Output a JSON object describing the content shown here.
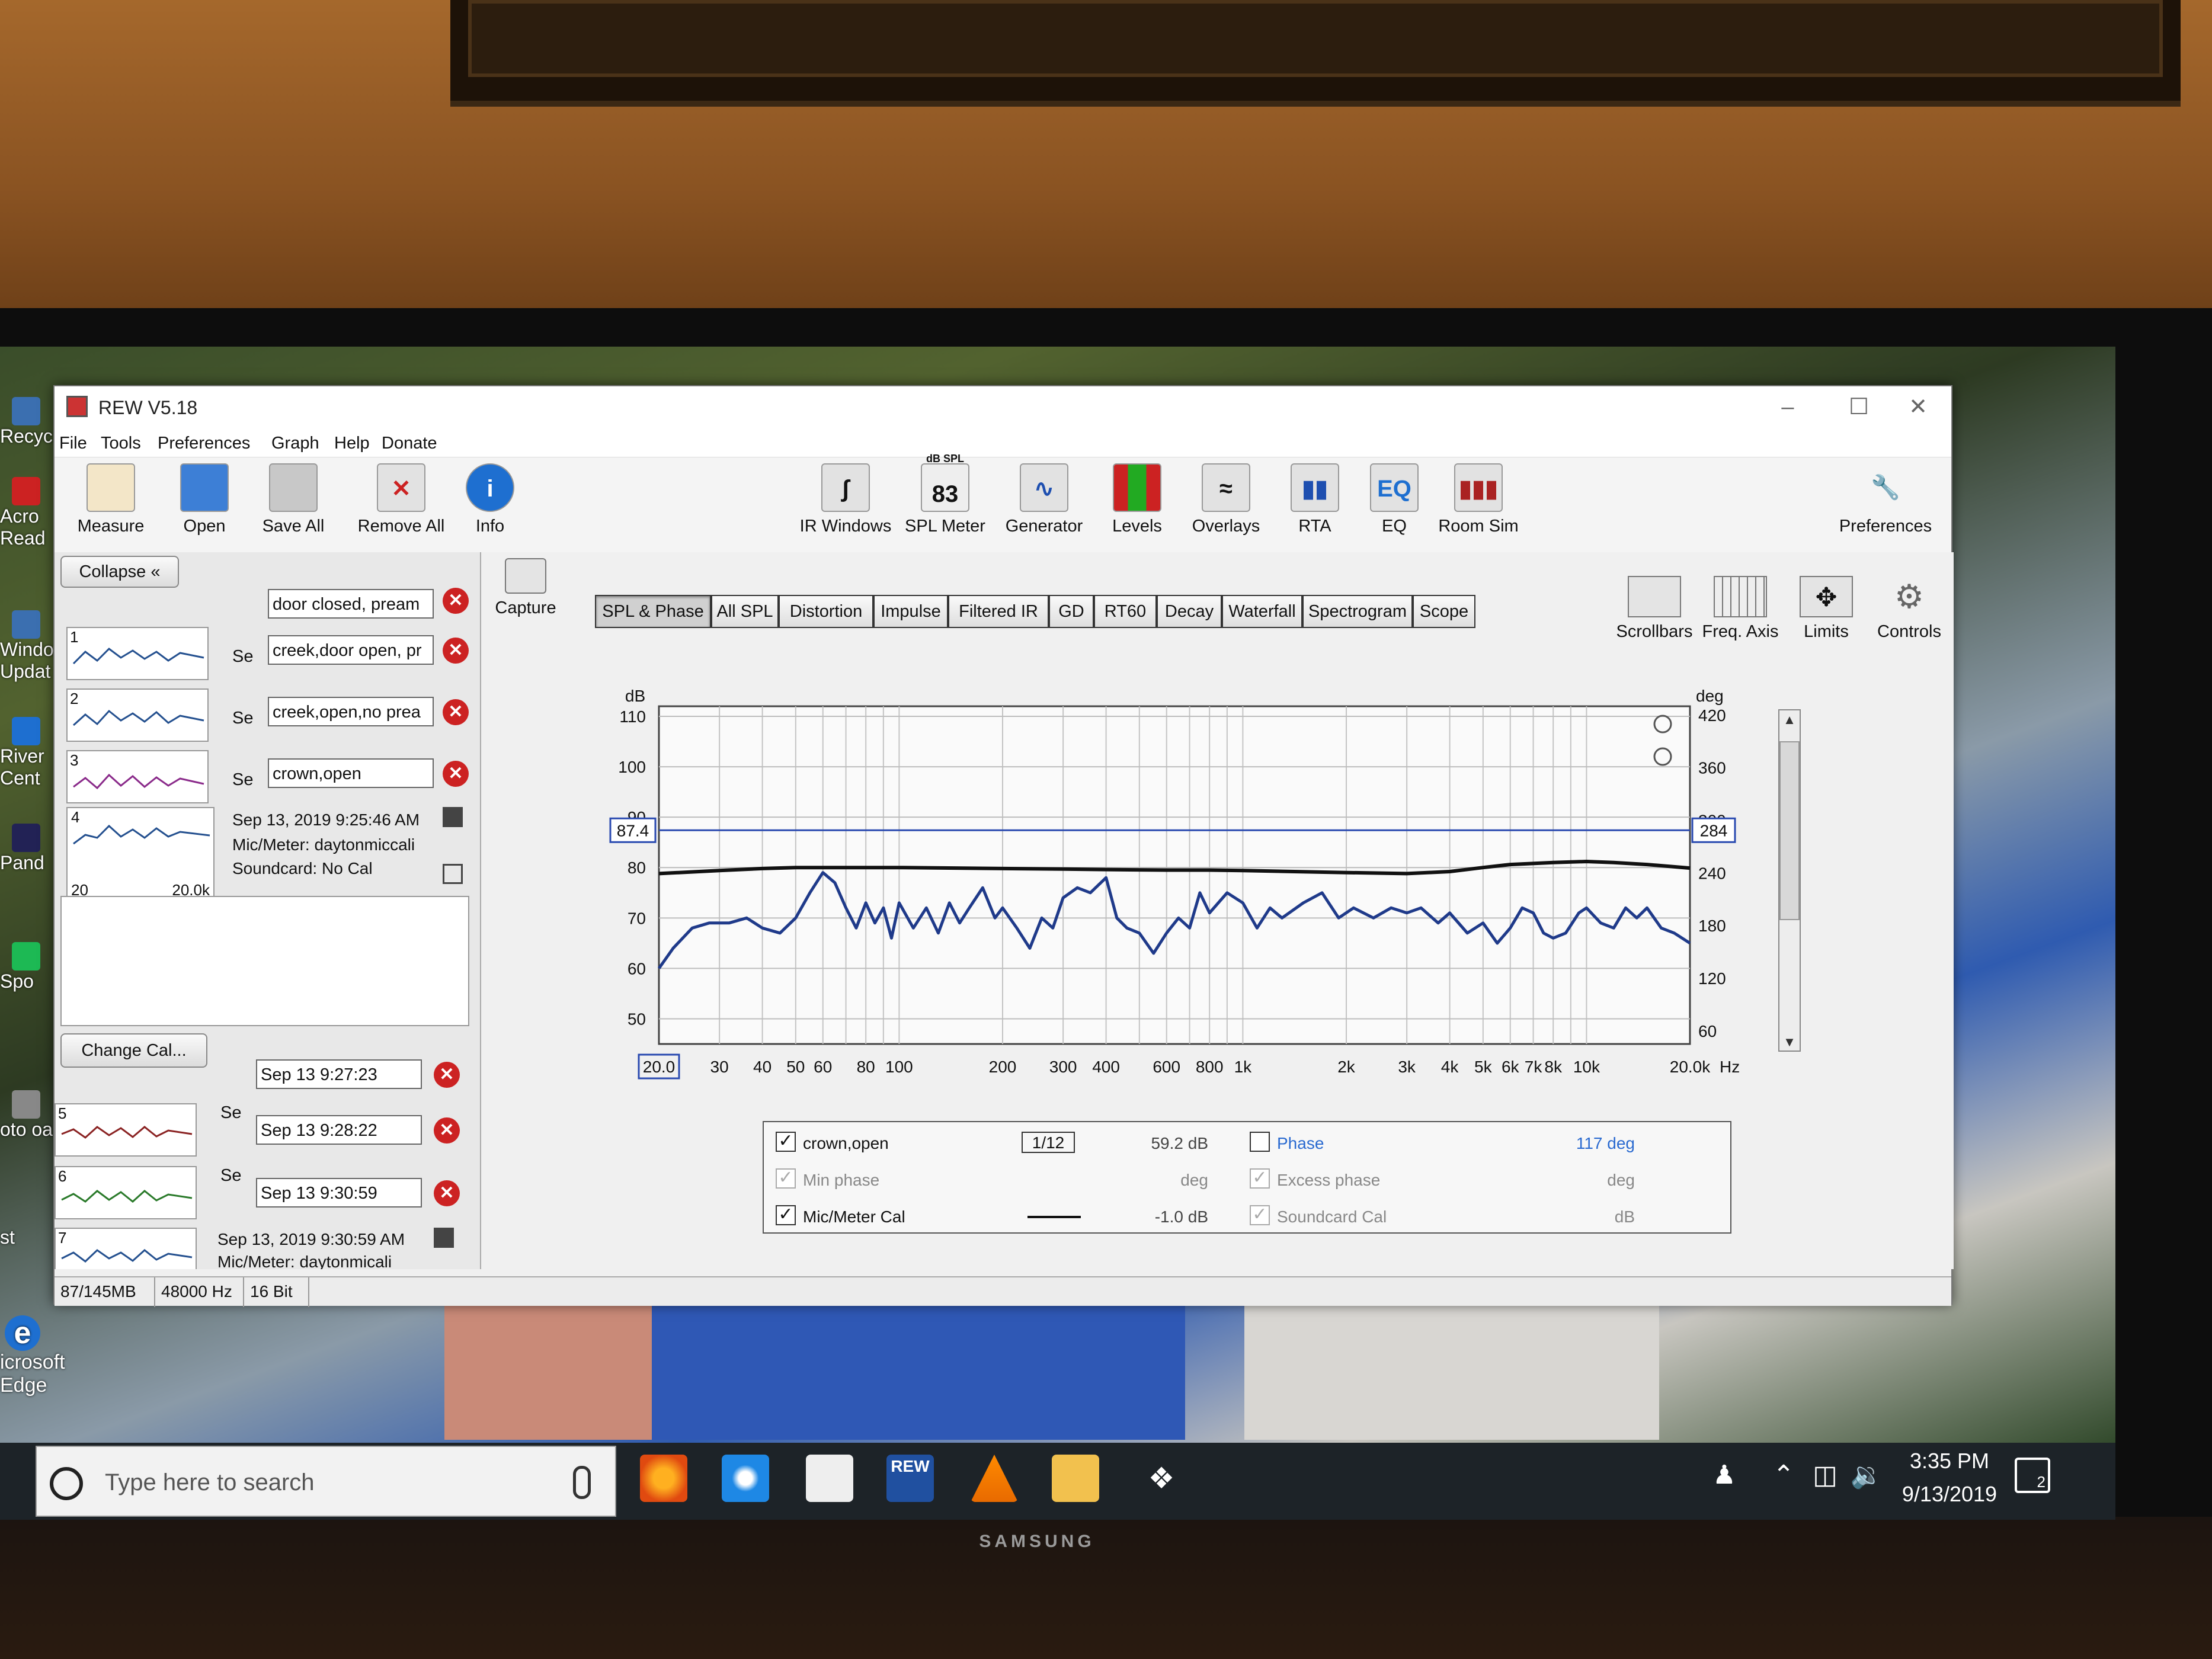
{
  "window": {
    "title": "REW V5.18"
  },
  "menu": [
    "File",
    "Tools",
    "Preferences",
    "Graph",
    "Help",
    "Donate"
  ],
  "toolbar_left": [
    {
      "label": "Measure",
      "icon": "measure-icon"
    },
    {
      "label": "Open",
      "icon": "folder-icon"
    },
    {
      "label": "Save All",
      "icon": "save-icon"
    },
    {
      "label": "Remove All",
      "icon": "remove-all-icon"
    },
    {
      "label": "Info",
      "icon": "info-icon"
    }
  ],
  "toolbar_mid": [
    {
      "label": "IR Windows",
      "icon": "ir-windows-icon"
    },
    {
      "label": "SPL Meter",
      "icon": "spl-meter-icon",
      "badge_top": "dB SPL",
      "badge_value": "83"
    },
    {
      "label": "Generator",
      "icon": "generator-icon"
    },
    {
      "label": "Levels",
      "icon": "levels-icon"
    },
    {
      "label": "Overlays",
      "icon": "overlays-icon"
    },
    {
      "label": "RTA",
      "icon": "rta-icon"
    },
    {
      "label": "EQ",
      "icon": "eq-icon",
      "badge_value": "EQ"
    },
    {
      "label": "Room Sim",
      "icon": "room-sim-icon"
    }
  ],
  "toolbar_right": {
    "label": "Preferences",
    "icon": "wrench-icon"
  },
  "left_panel": {
    "collapse_label": "Collapse",
    "measurements_top": [
      {
        "num": "1",
        "name": "door closed, pream",
        "se": "Se"
      },
      {
        "num": "2",
        "name": "creek,door open, pr",
        "se": "Se"
      },
      {
        "num": "3",
        "name": "creek,open,no prea",
        "se": "Se"
      },
      {
        "num": "4",
        "name": "crown,open",
        "se": "Se"
      }
    ],
    "detail": {
      "date": "Sep 13, 2019 9:25:46 AM",
      "mic": "Mic/Meter: daytonmiccali",
      "soundcard": "Soundcard: No Cal",
      "xmin": "20",
      "xmax": "20.0k"
    },
    "change_cal_label": "Change Cal...",
    "measurements_bottom": [
      {
        "num": "5",
        "name": "Sep 13 9:27:23",
        "se": "Se"
      },
      {
        "num": "6",
        "name": "Sep 13 9:28:22",
        "se": "Se"
      },
      {
        "num": "7",
        "name": "Sep 13 9:30:59",
        "se": "Se"
      }
    ],
    "last_row": {
      "date": "Sep 13, 2019 9:30:59 AM",
      "mic": "Mic/Meter: daytonmicali"
    }
  },
  "graph_tabs": [
    "SPL & Phase",
    "All SPL",
    "Distortion",
    "Impulse",
    "Filtered IR",
    "GD",
    "RT60",
    "Decay",
    "Waterfall",
    "Spectrogram",
    "Scope"
  ],
  "active_tab": "SPL & Phase",
  "capture_label": "Capture",
  "graph_tools": [
    {
      "label": "Scrollbars",
      "icon": "scrollbars-icon"
    },
    {
      "label": "Freq. Axis",
      "icon": "freq-axis-icon"
    },
    {
      "label": "Limits",
      "icon": "limits-icon"
    },
    {
      "label": "Controls",
      "icon": "gear-icon"
    }
  ],
  "chart_data": {
    "type": "line",
    "xscale": "log",
    "xlim": [
      20,
      20000
    ],
    "ylim": [
      45,
      112
    ],
    "y2lim": [
      45,
      430
    ],
    "ylabel": "dB",
    "y2label": "deg",
    "xunit": "Hz",
    "grid": true,
    "x_ticks": [
      "20.0",
      "30",
      "40",
      "50",
      "60",
      "80",
      "100",
      "200",
      "300",
      "400",
      "600",
      "800",
      "1k",
      "2k",
      "3k",
      "4k",
      "5k",
      "6k",
      "7k",
      "8k",
      "10k",
      "20.0k"
    ],
    "x_tick_values": [
      20,
      30,
      40,
      50,
      60,
      80,
      100,
      200,
      300,
      400,
      600,
      800,
      1000,
      2000,
      3000,
      4000,
      5000,
      6000,
      7000,
      8000,
      10000,
      20000
    ],
    "y_ticks": [
      110,
      100,
      90,
      80,
      70,
      60,
      50
    ],
    "y2_ticks": [
      420,
      360,
      300,
      240,
      180,
      120,
      60
    ],
    "cursor_y_label": "87.4",
    "cursor_y2_label": "284",
    "cursor_y": 87.4,
    "series": [
      {
        "name": "crown,open",
        "color": "#1f3a8a",
        "x": [
          20,
          22,
          25,
          28,
          32,
          36,
          40,
          45,
          50,
          55,
          60,
          65,
          70,
          75,
          80,
          85,
          90,
          95,
          100,
          110,
          120,
          130,
          140,
          150,
          160,
          175,
          190,
          200,
          220,
          240,
          260,
          280,
          300,
          330,
          360,
          400,
          430,
          460,
          500,
          550,
          600,
          650,
          700,
          750,
          800,
          900,
          1000,
          1100,
          1200,
          1300,
          1500,
          1700,
          1900,
          2100,
          2400,
          2700,
          3000,
          3300,
          3700,
          4000,
          4500,
          5000,
          5500,
          6000,
          6500,
          7000,
          7500,
          8000,
          8700,
          9500,
          10000,
          11000,
          12000,
          13000,
          14000,
          15000,
          16500,
          18000,
          20000
        ],
        "y": [
          60,
          64,
          68,
          69,
          69,
          70,
          68,
          67,
          70,
          75,
          79,
          77,
          72,
          68,
          73,
          69,
          72,
          66,
          73,
          68,
          72,
          67,
          73,
          69,
          72,
          76,
          70,
          72,
          68,
          64,
          70,
          68,
          74,
          76,
          75,
          78,
          70,
          68,
          67,
          63,
          67,
          70,
          68,
          75,
          71,
          75,
          73,
          68,
          72,
          70,
          73,
          75,
          70,
          72,
          70,
          72,
          71,
          72,
          69,
          71,
          67,
          69,
          65,
          68,
          72,
          71,
          67,
          66,
          67,
          71,
          72,
          69,
          68,
          72,
          70,
          72,
          68,
          67,
          65
        ]
      },
      {
        "name": "Mic/Meter Cal",
        "color": "#111111",
        "x": [
          20,
          30,
          40,
          50,
          60,
          80,
          100,
          200,
          300,
          400,
          600,
          800,
          1000,
          2000,
          3000,
          4000,
          5000,
          6000,
          8000,
          10000,
          12000,
          15000,
          20000
        ],
        "y": [
          78.8,
          79.4,
          79.8,
          80.0,
          80.0,
          80.0,
          80.0,
          79.8,
          79.7,
          79.6,
          79.5,
          79.5,
          79.4,
          79.0,
          78.8,
          79.2,
          80.0,
          80.6,
          81.0,
          81.2,
          81.0,
          80.6,
          79.9
        ]
      }
    ]
  },
  "legend": {
    "row1": {
      "name": "crown,open",
      "smoothing": "1/12",
      "value": "59.2 dB",
      "phase_label": "Phase",
      "phase_value": "117 deg"
    },
    "row2": {
      "name": "Min phase",
      "unit": "deg",
      "phase_label": "Excess phase",
      "phase_unit": "deg"
    },
    "row3": {
      "name": "Mic/Meter Cal",
      "value": "-1.0 dB",
      "phase_label": "Soundcard Cal",
      "phase_unit": "dB"
    }
  },
  "status": {
    "memory": "87/145MB",
    "rate": "48000 Hz",
    "bits": "16 Bit"
  },
  "desktop": {
    "icons": [
      "Recyc",
      "Acro Read",
      "Windo Updat",
      "River Cent",
      "Pand",
      "Spo",
      "oto oa",
      "st"
    ],
    "edge_label": "icrosoft Edge"
  },
  "taskbar": {
    "search_placeholder": "Type here to search",
    "time": "3:35 PM",
    "date": "9/13/2019",
    "notif_count": "2"
  },
  "tv_brand": "SAMSUNG"
}
